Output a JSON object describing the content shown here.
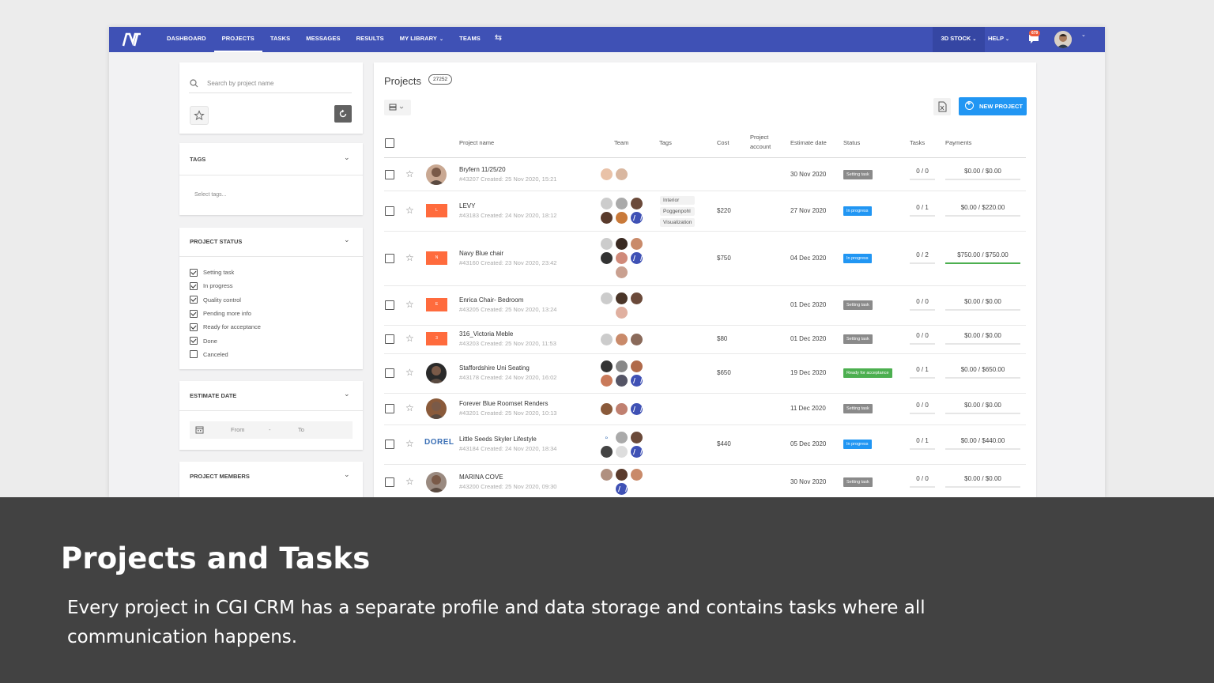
{
  "topbar": {
    "nav": [
      {
        "label": "DASHBOARD"
      },
      {
        "label": "PROJECTS",
        "active": true
      },
      {
        "label": "TASKS"
      },
      {
        "label": "MESSAGES"
      },
      {
        "label": "RESULTS"
      },
      {
        "label": "MY LIBRARY",
        "dropdown": true
      },
      {
        "label": "TEAMS"
      }
    ],
    "stock_label": "3D STOCK",
    "help_label": "HELP",
    "notifications_count": "679",
    "accent_color": "#3f51b5"
  },
  "sidebar": {
    "search_placeholder": "Search by project name",
    "tags": {
      "title": "TAGS",
      "placeholder": "Select tags..."
    },
    "project_status": {
      "title": "PROJECT STATUS",
      "options": [
        {
          "label": "Setting task",
          "checked": true
        },
        {
          "label": "In progress",
          "checked": true
        },
        {
          "label": "Quality control",
          "checked": true
        },
        {
          "label": "Pending more info",
          "checked": true
        },
        {
          "label": "Ready for acceptance",
          "checked": true
        },
        {
          "label": "Done",
          "checked": true
        },
        {
          "label": "Canceled",
          "checked": false
        }
      ]
    },
    "estimate_date": {
      "title": "ESTIMATE DATE",
      "from": "From",
      "sep": "-",
      "to": "To"
    },
    "project_members": {
      "title": "PROJECT MEMBERS"
    }
  },
  "main": {
    "title": "Projects",
    "count": "27252",
    "new_project_label": "NEW PROJECT",
    "columns": {
      "name": "Project name",
      "team": "Team",
      "tags": "Tags",
      "cost": "Cost",
      "account": "Project account",
      "estimate": "Estimate date",
      "status": "Status",
      "tasks": "Tasks",
      "payments": "Payments"
    },
    "rows": [
      {
        "name": "Bryfern 11/25/20",
        "sub": "#43207 Created: 25 Nov 2020, 15:21",
        "thumb": "photo",
        "tags": [],
        "cost": "",
        "estimate": "30 Nov 2020",
        "status": "Setting task",
        "status_kind": "set",
        "tasks": "0 / 0",
        "payments": "$0.00 /  $0.00"
      },
      {
        "name": "LEVY",
        "sub": "#43183 Created: 24 Nov 2020, 18:12",
        "thumb": "L",
        "tags": [
          "Interior",
          "Poggenpohl",
          "Visualization"
        ],
        "cost": "$220",
        "estimate": "27 Nov 2020",
        "status": "In progress",
        "status_kind": "prog",
        "tasks": "0 / 1",
        "payments": "$0.00 /  $220.00"
      },
      {
        "name": "Navy Blue chair",
        "sub": "#43160 Created: 23 Nov 2020, 23:42",
        "thumb": "N",
        "tags": [],
        "cost": "$750",
        "estimate": "04 Dec 2020",
        "status": "In progress",
        "status_kind": "prog",
        "tasks": "0 / 2",
        "payments": "$750.00 /  $750.00",
        "paid_full": true
      },
      {
        "name": "Enrica Chair- Bedroom",
        "sub": "#43205 Created: 25 Nov 2020, 13:24",
        "thumb": "E",
        "tags": [],
        "cost": "",
        "estimate": "01 Dec 2020",
        "status": "Setting task",
        "status_kind": "set",
        "tasks": "0 / 0",
        "payments": "$0.00 /  $0.00"
      },
      {
        "name": "316_Victoria Meble",
        "sub": "#43203 Created: 25 Nov 2020, 11:53",
        "thumb": "3",
        "tags": [],
        "cost": "$80",
        "estimate": "01 Dec 2020",
        "status": "Setting task",
        "status_kind": "set",
        "tasks": "0 / 0",
        "payments": "$0.00 /  $0.00"
      },
      {
        "name": "Staffordshire Uni Seating",
        "sub": "#43178 Created: 24 Nov 2020, 16:02",
        "thumb": "photo",
        "tags": [],
        "cost": "$650",
        "estimate": "19 Dec 2020",
        "status": "Ready for acceptance",
        "status_kind": "ready",
        "tasks": "0 / 1",
        "payments": "$0.00 /  $650.00"
      },
      {
        "name": "Forever Blue Roomset Renders",
        "sub": "#43201 Created: 25 Nov 2020, 10:13",
        "thumb": "photo",
        "tags": [],
        "cost": "",
        "estimate": "11 Dec 2020",
        "status": "Setting task",
        "status_kind": "set",
        "tasks": "0 / 0",
        "payments": "$0.00 /  $0.00"
      },
      {
        "name": "Little Seeds Skyler Lifestyle",
        "sub": "#43184 Created: 24 Nov 2020, 18:34",
        "thumb": "DOREL",
        "tags": [],
        "cost": "$440",
        "estimate": "05 Dec 2020",
        "status": "In progress",
        "status_kind": "prog",
        "tasks": "0 / 1",
        "payments": "$0.00 /  $440.00"
      },
      {
        "name": "MARINA COVE",
        "sub": "#43200 Created: 25 Nov 2020, 09:30",
        "thumb": "photo",
        "tags": [],
        "cost": "",
        "estimate": "30 Nov 2020",
        "status": "Setting task",
        "status_kind": "set",
        "tasks": "0 / 0",
        "payments": "$0.00 /  $0.00"
      }
    ]
  },
  "caption": {
    "title": "Projects and Tasks",
    "text": "Every project in CGI CRM has a separate profile and data storage and contains tasks where all communication happens."
  }
}
